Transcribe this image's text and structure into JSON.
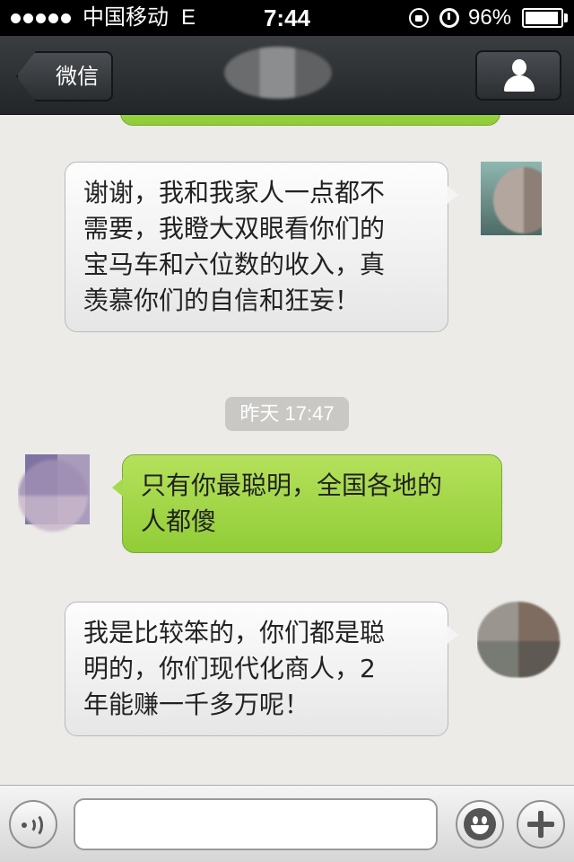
{
  "status_bar": {
    "carrier": "中国移动",
    "network": "E",
    "time": "7:44",
    "battery_percent": "96%",
    "battery_level": 0.96,
    "icons": [
      "signal-dots-icon",
      "rotation-lock-icon",
      "alarm-icon",
      "battery-icon"
    ]
  },
  "nav_bar": {
    "back_label": "微信",
    "right_icon": "profile-icon"
  },
  "chat": {
    "messages": [
      {
        "side": "incoming",
        "lines": [
          "谢谢，我和我家人一点都不",
          "需要，我瞪大双眼看你们的",
          "宝马车和六位数的收入，真",
          "羡慕你们的自信和狂妄！"
        ]
      },
      {
        "side": "outgoing",
        "lines": [
          "只有你最聪明，全国各地的",
          "人都傻"
        ]
      },
      {
        "side": "incoming",
        "lines": [
          "我是比较笨的，你们都是聪",
          "明的，你们现代化商人，2",
          "年能赚一千多万呢！"
        ]
      }
    ],
    "timestamp": "昨天 17:47"
  },
  "input_bar": {
    "left_icon": "voice-icon",
    "text_value": "",
    "emoji_icon": "smiley-icon",
    "plus_icon": "plus-icon"
  },
  "colors": {
    "incoming_bubble": "#f2f2f2",
    "outgoing_bubble": "#a6d94c",
    "nav_background": "#2e3134",
    "chat_background": "#ecebe7"
  }
}
